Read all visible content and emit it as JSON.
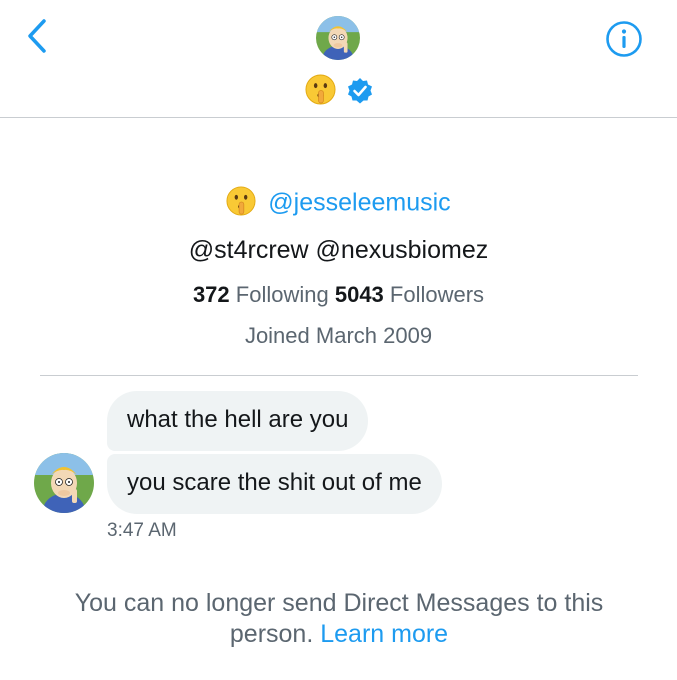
{
  "header": {
    "back_icon": "chevron-left-icon",
    "info_icon": "info-icon",
    "avatar_icon": "avatar",
    "name_emoji": "🤫",
    "verified_icon": "verified-badge-icon",
    "accent_color": "#1d9bf0"
  },
  "profile": {
    "bio_emoji": "🤫",
    "bio_link": "@jesseleemusic",
    "bio_line2": "@st4rcrew @nexusbiomez",
    "following_count": "372",
    "following_label": "Following",
    "followers_count": "5043",
    "followers_label": "Followers",
    "joined": "Joined March 2009"
  },
  "messages": [
    {
      "text": "what the hell are you"
    },
    {
      "text": "you scare the shit out of me"
    }
  ],
  "timestamp": "3:47 AM",
  "notice": {
    "text": "You can no longer send Direct Messages to this person.",
    "link": "Learn more"
  }
}
